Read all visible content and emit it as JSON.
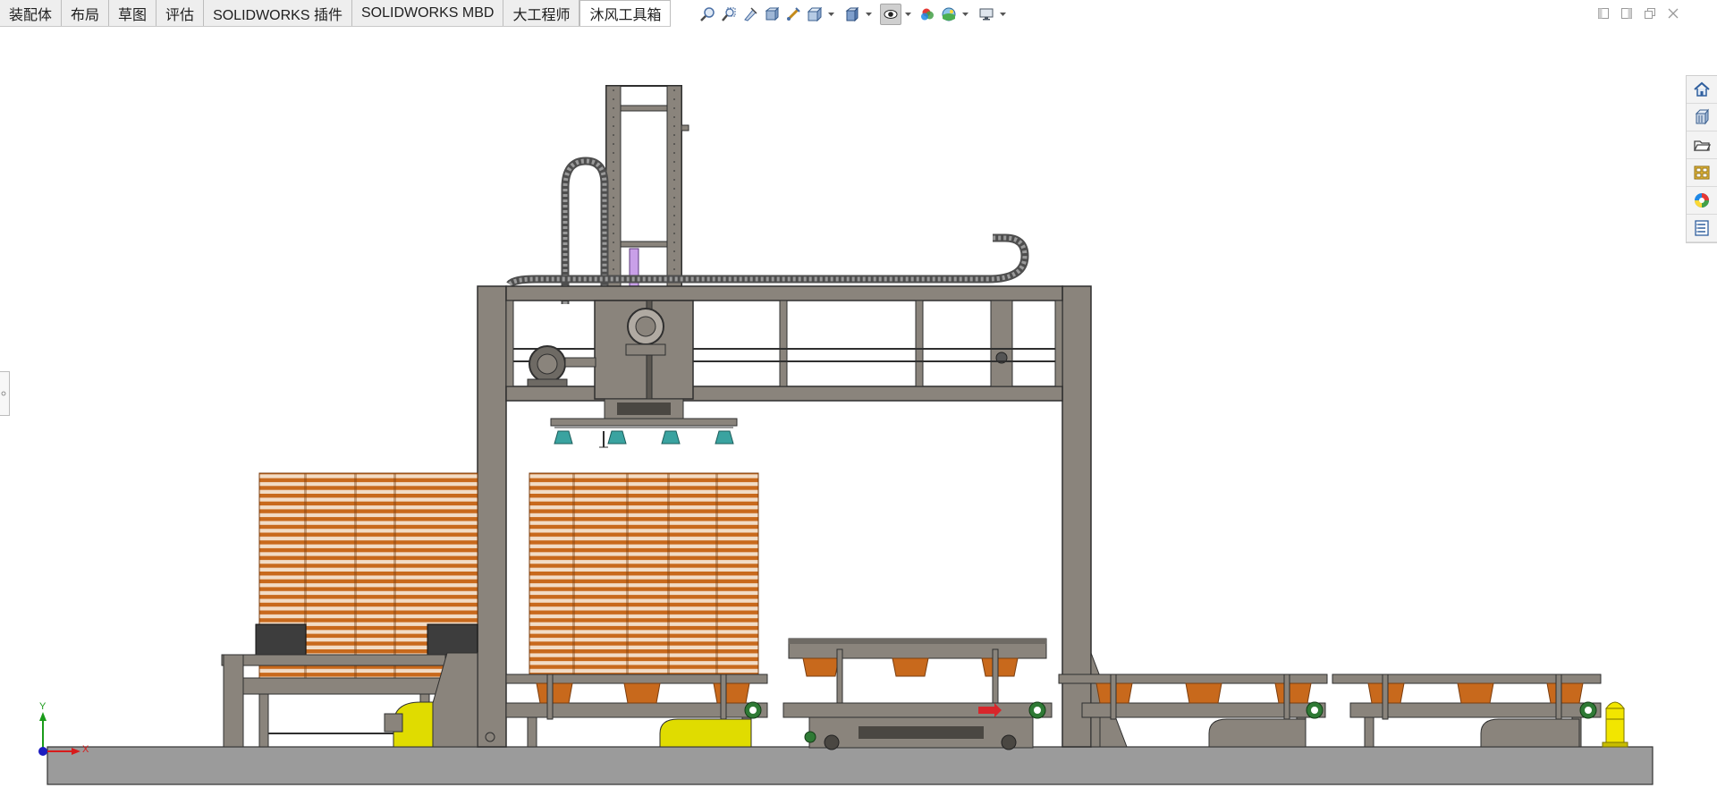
{
  "command_tabs": [
    {
      "label": "装配体",
      "active": false
    },
    {
      "label": "布局",
      "active": false
    },
    {
      "label": "草图",
      "active": false
    },
    {
      "label": "评估",
      "active": false
    },
    {
      "label": "SOLIDWORKS 插件",
      "active": false
    },
    {
      "label": "SOLIDWORKS MBD",
      "active": false
    },
    {
      "label": "大工程师",
      "active": false
    },
    {
      "label": "沐风工具箱",
      "active": true
    }
  ],
  "hud_icons": [
    "zoom-to-fit-icon",
    "zoom-to-area-icon",
    "previous-view-icon",
    "section-view-icon",
    "dynamic-annotation-icon",
    "view-orientation-icon",
    "display-style-icon",
    "hide-show-items-icon",
    "edit-appearance-icon",
    "apply-scene-icon",
    "view-settings-icon"
  ],
  "window_controls": [
    "tile-left-icon",
    "tile-right-icon",
    "restore-window-icon",
    "close-window-icon"
  ],
  "task_pane": [
    "home-icon",
    "design-library-icon",
    "file-explorer-icon",
    "view-palette-icon",
    "appearances-icon",
    "custom-properties-icon"
  ],
  "triad": {
    "y_label": "Y",
    "x_label": "X"
  },
  "colors": {
    "frame": "#8a847c",
    "frame_dark": "#4a4742",
    "tray": "#c8691c",
    "tray_light": "#f4e0cd",
    "motor_yellow": "#e0dc00",
    "gear_green": "#2f7a35",
    "floor": "#9b9b9b",
    "cable": "#5a5a5a",
    "suction": "#3aa3a0",
    "arrow_red": "#d8262b",
    "triad_green": "#1a9b1a",
    "triad_red": "#d81b1b",
    "triad_blue": "#1c1cc0"
  }
}
